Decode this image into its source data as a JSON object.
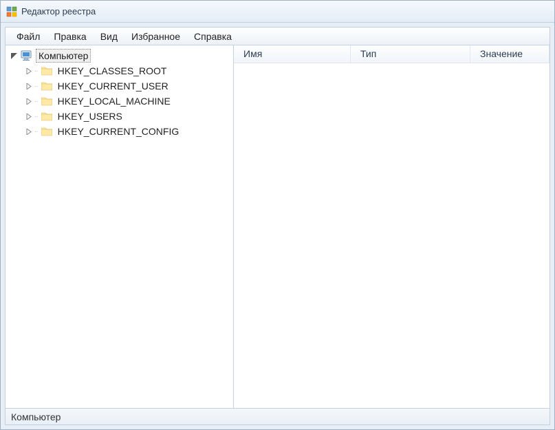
{
  "window": {
    "title": "Редактор реестра"
  },
  "menu": {
    "file": "Файл",
    "edit": "Правка",
    "view": "Вид",
    "favorites": "Избранное",
    "help": "Справка"
  },
  "tree": {
    "root": "Компьютер",
    "hives": [
      "HKEY_CLASSES_ROOT",
      "HKEY_CURRENT_USER",
      "HKEY_LOCAL_MACHINE",
      "HKEY_USERS",
      "HKEY_CURRENT_CONFIG"
    ]
  },
  "columns": {
    "name": "Имя",
    "type": "Тип",
    "value": "Значение"
  },
  "status": {
    "path": "Компьютер"
  }
}
